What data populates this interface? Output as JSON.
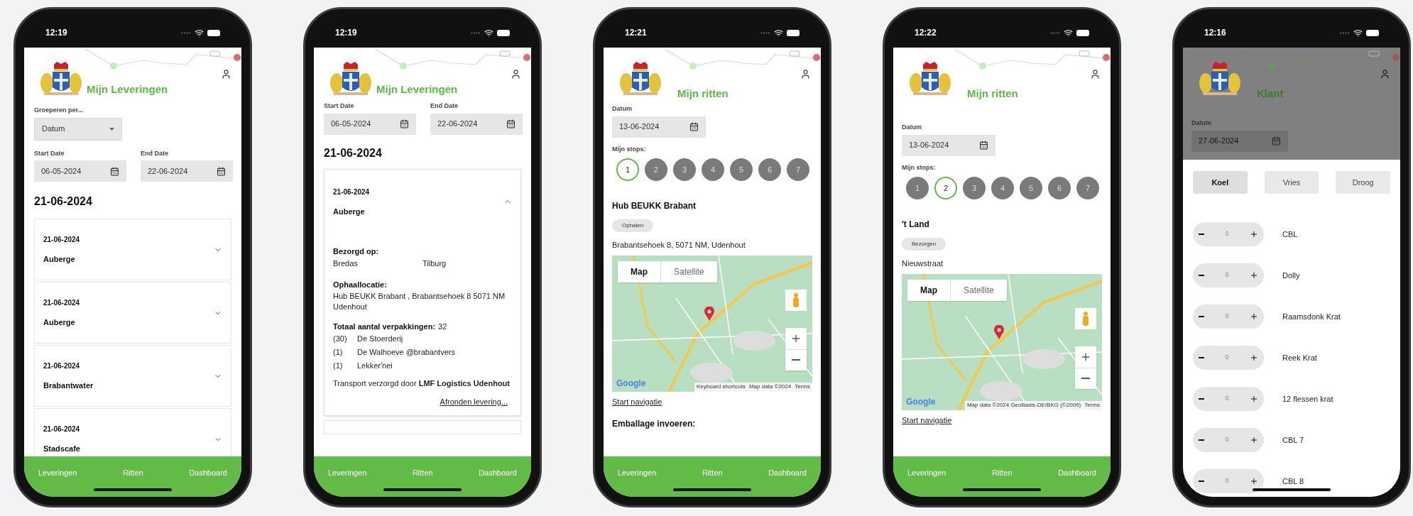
{
  "phones": [
    {
      "kind": "deliveries",
      "time": "12:19",
      "title": "Mijn Leveringen",
      "dimmed": false,
      "group_by": {
        "label": "Groeperen per...",
        "value": "Datum"
      },
      "start_date": {
        "label": "Start Date",
        "value": "06-05-2024"
      },
      "end_date": {
        "label": "End Date",
        "value": "22-06-2024"
      },
      "date_heading": "21-06-2024",
      "deliveries": [
        {
          "date": "21-06-2024",
          "name": "Auberge",
          "expanded": false
        },
        {
          "date": "21-06-2024",
          "name": "Auberge",
          "expanded": false
        },
        {
          "date": "21-06-2024",
          "name": "Brabantwater",
          "expanded": false
        },
        {
          "date": "21-06-2024",
          "name": "Stadscafe",
          "expanded": false
        }
      ],
      "nav": [
        "Leveringen",
        "Ritten",
        "Dashboard"
      ]
    },
    {
      "kind": "delivery_detail",
      "time": "12:19",
      "title": "Mijn Leveringen",
      "dimmed": false,
      "start_date": {
        "label": "Start Date",
        "value": "06-05-2024"
      },
      "end_date": {
        "label": "End Date",
        "value": "22-06-2024"
      },
      "date_heading": "21-06-2024",
      "delivery": {
        "date": "21-06-2024",
        "name": "Auberge",
        "expanded": true,
        "delivered_to": {
          "label": "Bezorgd op:",
          "values": [
            "Bredas",
            "Tilburg"
          ]
        },
        "pickup": {
          "label": "Ophaallocatie:",
          "value": "Hub BEUKK Brabant , Brabantsehoek 8 5071 NM Udenhout"
        },
        "total": {
          "label": "Totaal aantal verpakkingen:",
          "value": "32"
        },
        "packages": [
          {
            "count": "(30)",
            "name": "De Stoerderij"
          },
          {
            "count": "(1)",
            "name": "De Walhoeve @brabantvers"
          },
          {
            "count": "(1)",
            "name": "Lekker'nei"
          }
        ],
        "transport": "Transport verzorgd door **LMF Logistics Udenhout**",
        "finish_link": "Afronden levering..."
      },
      "nav": [
        "Leveringen",
        "Ritten",
        "Dashboard"
      ]
    },
    {
      "kind": "trip",
      "time": "12:21",
      "title": "Mijn ritten",
      "dimmed": false,
      "date": {
        "label": "Datum",
        "value": "13-06-2024"
      },
      "stops_label": "Mijn stops:",
      "stops": [
        {
          "label": "1",
          "selected": true
        },
        {
          "label": "2",
          "selected": false
        },
        {
          "label": "3",
          "selected": false
        },
        {
          "label": "4",
          "selected": false
        },
        {
          "label": "5",
          "selected": false
        },
        {
          "label": "6",
          "selected": false
        },
        {
          "label": "7",
          "selected": false
        }
      ],
      "stop_name": "Hub BEUKK Brabant",
      "stop_type": "Ophalen",
      "address": "Brabantsehoek 8, 5071 NM, Udenhout",
      "map": {
        "toggle": [
          {
            "label": "Map",
            "selected": true
          },
          {
            "label": "Satellite",
            "selected": false
          }
        ],
        "logo": "Google",
        "attribution": [
          "Keyboard shortcuts",
          "Map data ©2024",
          "Terms"
        ]
      },
      "navigation_link": "Start navigatie",
      "section": "Emballage invoeren:",
      "nav": [
        "Leveringen",
        "Ritten",
        "Dashboard"
      ]
    },
    {
      "kind": "trip",
      "time": "12:22",
      "title": "Mijn ritten",
      "dimmed": false,
      "date": {
        "label": "Datum",
        "value": "13-06-2024"
      },
      "stops_label": "Mijn stops:",
      "stops": [
        {
          "label": "1",
          "selected": false
        },
        {
          "label": "2",
          "selected": true
        },
        {
          "label": "3",
          "selected": false
        },
        {
          "label": "4",
          "selected": false
        },
        {
          "label": "5",
          "selected": false
        },
        {
          "label": "6",
          "selected": false
        },
        {
          "label": "7",
          "selected": false
        }
      ],
      "stop_name": "'t Land",
      "stop_type": "Bezorgen",
      "address": "Nieuwstraat",
      "map": {
        "toggle": [
          {
            "label": "Map",
            "selected": true
          },
          {
            "label": "Satellite",
            "selected": false
          }
        ],
        "logo": "Google",
        "attribution": [
          "Map data ©2024 GeoBasis-DE/BKG (©2009)",
          "Terms"
        ]
      },
      "navigation_link": "Start navigatie",
      "nav": [
        "Leveringen",
        "Ritten",
        "Dashboard"
      ]
    },
    {
      "kind": "packaging",
      "time": "12:16",
      "title": "Klant",
      "dimmed": true,
      "date": {
        "label": "Datum",
        "value": "27-06-2024"
      },
      "tabs": [
        {
          "label": "Koel",
          "selected": true
        },
        {
          "label": "Vries",
          "selected": false
        },
        {
          "label": "Droog",
          "selected": false
        }
      ],
      "items": [
        {
          "name": "CBL",
          "quantity": "0"
        },
        {
          "name": "Dolly",
          "quantity": "0"
        },
        {
          "name": "Raamsdonk Krat",
          "quantity": "0"
        },
        {
          "name": "Reek Krat",
          "quantity": "0"
        },
        {
          "name": "12 flessen krat",
          "quantity": "0"
        },
        {
          "name": "CBL 7",
          "quantity": "0"
        },
        {
          "name": "CBL 8",
          "quantity": "0"
        }
      ]
    }
  ]
}
